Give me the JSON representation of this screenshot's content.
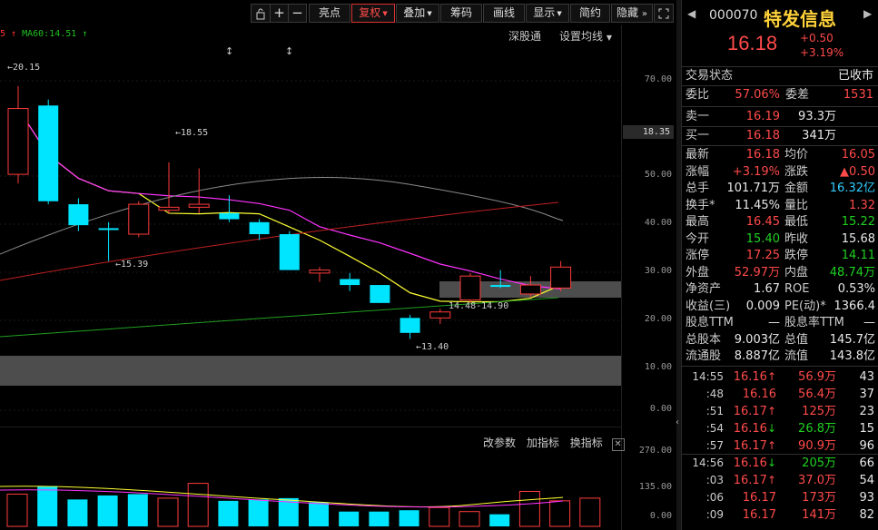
{
  "toolbar": {
    "buttons": [
      {
        "label": "亮点"
      },
      {
        "label": "复权",
        "dropdown": true,
        "active": true
      },
      {
        "label": "叠加",
        "dropdown": true
      },
      {
        "label": "筹码"
      },
      {
        "label": "画线"
      },
      {
        "label": "显示",
        "dropdown": true
      },
      {
        "label": "简约"
      },
      {
        "label": "隐藏"
      }
    ],
    "icons": [
      "lock-icon",
      "plus-icon",
      "minus-icon",
      "double-chevron-right-icon",
      "expand-icon"
    ]
  },
  "ma_legend": {
    "prefix": "5 ↑",
    "ma60_label": "MA60:14.51",
    "ma60_arrow": "↑"
  },
  "pane_links": {
    "shengutong": "深股通",
    "ma_settings": "设置均线"
  },
  "price_axis": [
    "70.00",
    "50.00",
    "40.00",
    "30.00",
    "20.00",
    "10.00",
    "0.00"
  ],
  "current_price_label": "18.35",
  "volume_axis": [
    "270.00",
    "135.00",
    "0.00"
  ],
  "volume_toolbar": {
    "change_params": "改参数",
    "add_indicator": "加指标",
    "switch_indicator": "换指标"
  },
  "chart_data": {
    "type": "candlestick",
    "annotations": [
      "20.15",
      "18.55",
      "15.39",
      "14.48-14.90",
      "13.40"
    ],
    "candles": [
      {
        "o": 17.2,
        "c": 19.4,
        "h": 20.15,
        "l": 16.9,
        "dir": "up"
      },
      {
        "o": 19.5,
        "c": 16.3,
        "h": 19.7,
        "l": 16.2,
        "dir": "down"
      },
      {
        "o": 16.2,
        "c": 15.5,
        "h": 16.4,
        "l": 15.3,
        "dir": "down"
      },
      {
        "o": 15.4,
        "c": 15.4,
        "h": 15.6,
        "l": 14.3,
        "dir": "flat"
      },
      {
        "o": 15.2,
        "c": 16.2,
        "h": 16.3,
        "l": 15.1,
        "dir": "up"
      },
      {
        "o": 16.0,
        "c": 16.1,
        "h": 17.6,
        "l": 15.9,
        "dir": "up"
      },
      {
        "o": 16.1,
        "c": 16.2,
        "h": 17.4,
        "l": 15.9,
        "dir": "up"
      },
      {
        "o": 15.9,
        "c": 15.7,
        "h": 16.5,
        "l": 15.6,
        "dir": "down"
      },
      {
        "o": 15.6,
        "c": 15.2,
        "h": 15.7,
        "l": 15.0,
        "dir": "down"
      },
      {
        "o": 15.2,
        "c": 14.0,
        "h": 15.3,
        "l": 14.0,
        "dir": "down"
      },
      {
        "o": 14.0,
        "c": 13.9,
        "h": 14.1,
        "l": 13.6,
        "dir": "up"
      },
      {
        "o": 13.7,
        "c": 13.5,
        "h": 13.9,
        "l": 13.3,
        "dir": "down"
      },
      {
        "o": 13.5,
        "c": 12.9,
        "h": 13.5,
        "l": 12.9,
        "dir": "down"
      },
      {
        "o": 12.4,
        "c": 11.9,
        "h": 12.5,
        "l": 11.7,
        "dir": "down"
      },
      {
        "o": 12.4,
        "c": 12.6,
        "h": 12.7,
        "l": 12.2,
        "dir": "up"
      },
      {
        "o": 13.0,
        "c": 13.8,
        "h": 13.9,
        "l": 12.9,
        "dir": "up"
      },
      {
        "o": 13.5,
        "c": 13.5,
        "h": 14.0,
        "l": 13.4,
        "dir": "flat"
      },
      {
        "o": 13.2,
        "c": 13.5,
        "h": 13.8,
        "l": 13.1,
        "dir": "up"
      },
      {
        "o": 13.4,
        "c": 14.1,
        "h": 14.3,
        "l": 13.3,
        "dir": "up"
      }
    ],
    "volumes": [
      120,
      150,
      100,
      115,
      120,
      105,
      160,
      95,
      100,
      105,
      90,
      55,
      55,
      60,
      70,
      55,
      45,
      130,
      95,
      105
    ]
  },
  "quote": {
    "code": "000070",
    "name": "特发信息",
    "price": "16.18",
    "change": "+0.50",
    "change_pct": "+3.19%",
    "status_label": "交易状态",
    "status_value": "已收市",
    "weibi_label": "委比",
    "weibi_value": "57.06%",
    "weicha_label": "委差",
    "weicha_value": "1531",
    "sell1_label": "卖一",
    "sell1_price": "16.19",
    "sell1_vol": "93.3万",
    "buy1_label": "买一",
    "buy1_price": "16.18",
    "buy1_vol": "341万",
    "fields": [
      {
        "l1": "最新",
        "v1": "16.18",
        "c1": "red",
        "l2": "均价",
        "v2": "16.05",
        "c2": "red"
      },
      {
        "l1": "涨幅",
        "v1": "+3.19%",
        "c1": "red",
        "l2": "涨跌",
        "v2": "▲0.50",
        "c2": "red"
      },
      {
        "l1": "总手",
        "v1": "101.71万",
        "c1": "white",
        "l2": "金额",
        "v2": "16.32亿",
        "c2": "cyan"
      },
      {
        "l1": "换手*",
        "v1": "11.45%",
        "c1": "white",
        "l2": "量比",
        "v2": "1.32",
        "c2": "red"
      },
      {
        "l1": "最高",
        "v1": "16.45",
        "c1": "red",
        "l2": "最低",
        "v2": "15.22",
        "c2": "green"
      },
      {
        "l1": "今开",
        "v1": "15.40",
        "c1": "green",
        "l2": "昨收",
        "v2": "15.68",
        "c2": "white"
      },
      {
        "l1": "涨停",
        "v1": "17.25",
        "c1": "red",
        "l2": "跌停",
        "v2": "14.11",
        "c2": "green"
      },
      {
        "l1": "外盘",
        "v1": "52.97万",
        "c1": "red",
        "l2": "内盘",
        "v2": "48.74万",
        "c2": "green"
      },
      {
        "l1": "净资产",
        "v1": "1.67",
        "c1": "white",
        "l2": "ROE",
        "v2": "0.53%",
        "c2": "white"
      },
      {
        "l1": "收益(三)",
        "v1": "0.009",
        "c1": "white",
        "l2": "PE(动)*",
        "v2": "1366.4",
        "c2": "white"
      },
      {
        "l1": "股息TTM",
        "v1": "—",
        "c1": "white",
        "l2": "股息率TTM",
        "v2": "—",
        "c2": "white"
      },
      {
        "l1": "总股本",
        "v1": "9.003亿",
        "c1": "white",
        "l2": "总值",
        "v2": "145.7亿",
        "c2": "white"
      },
      {
        "l1": "流通股",
        "v1": "8.887亿",
        "c1": "white",
        "l2": "流值",
        "v2": "143.8亿",
        "c2": "white"
      }
    ],
    "ticks": [
      {
        "time": "14:55",
        "price": "16.16",
        "arrow": "↑",
        "arrow_color": "red",
        "vol": "56.9万",
        "vol_color": "red",
        "n": "43"
      },
      {
        "time": ":48",
        "price": "16.16",
        "arrow": "",
        "arrow_color": "red",
        "vol": "56.4万",
        "vol_color": "red",
        "n": "37"
      },
      {
        "time": ":51",
        "price": "16.17",
        "arrow": "↑",
        "arrow_color": "red",
        "vol": "125万",
        "vol_color": "red",
        "n": "23"
      },
      {
        "time": ":54",
        "price": "16.16",
        "arrow": "↓",
        "arrow_color": "green",
        "vol": "26.8万",
        "vol_color": "green",
        "n": "15"
      },
      {
        "time": ":57",
        "price": "16.17",
        "arrow": "↑",
        "arrow_color": "red",
        "vol": "90.9万",
        "vol_color": "red",
        "n": "96"
      },
      {
        "time": "14:56",
        "price": "16.16",
        "arrow": "↓",
        "arrow_color": "green",
        "vol": "205万",
        "vol_color": "green",
        "n": "66"
      },
      {
        "time": ":03",
        "price": "16.17",
        "arrow": "↑",
        "arrow_color": "red",
        "vol": "37.0万",
        "vol_color": "red",
        "n": "54"
      },
      {
        "time": ":06",
        "price": "16.17",
        "arrow": "",
        "arrow_color": "red",
        "vol": "173万",
        "vol_color": "red",
        "n": "93"
      },
      {
        "time": ":09",
        "price": "16.17",
        "arrow": "",
        "arrow_color": "red",
        "vol": "141万",
        "vol_color": "red",
        "n": "82"
      }
    ]
  }
}
